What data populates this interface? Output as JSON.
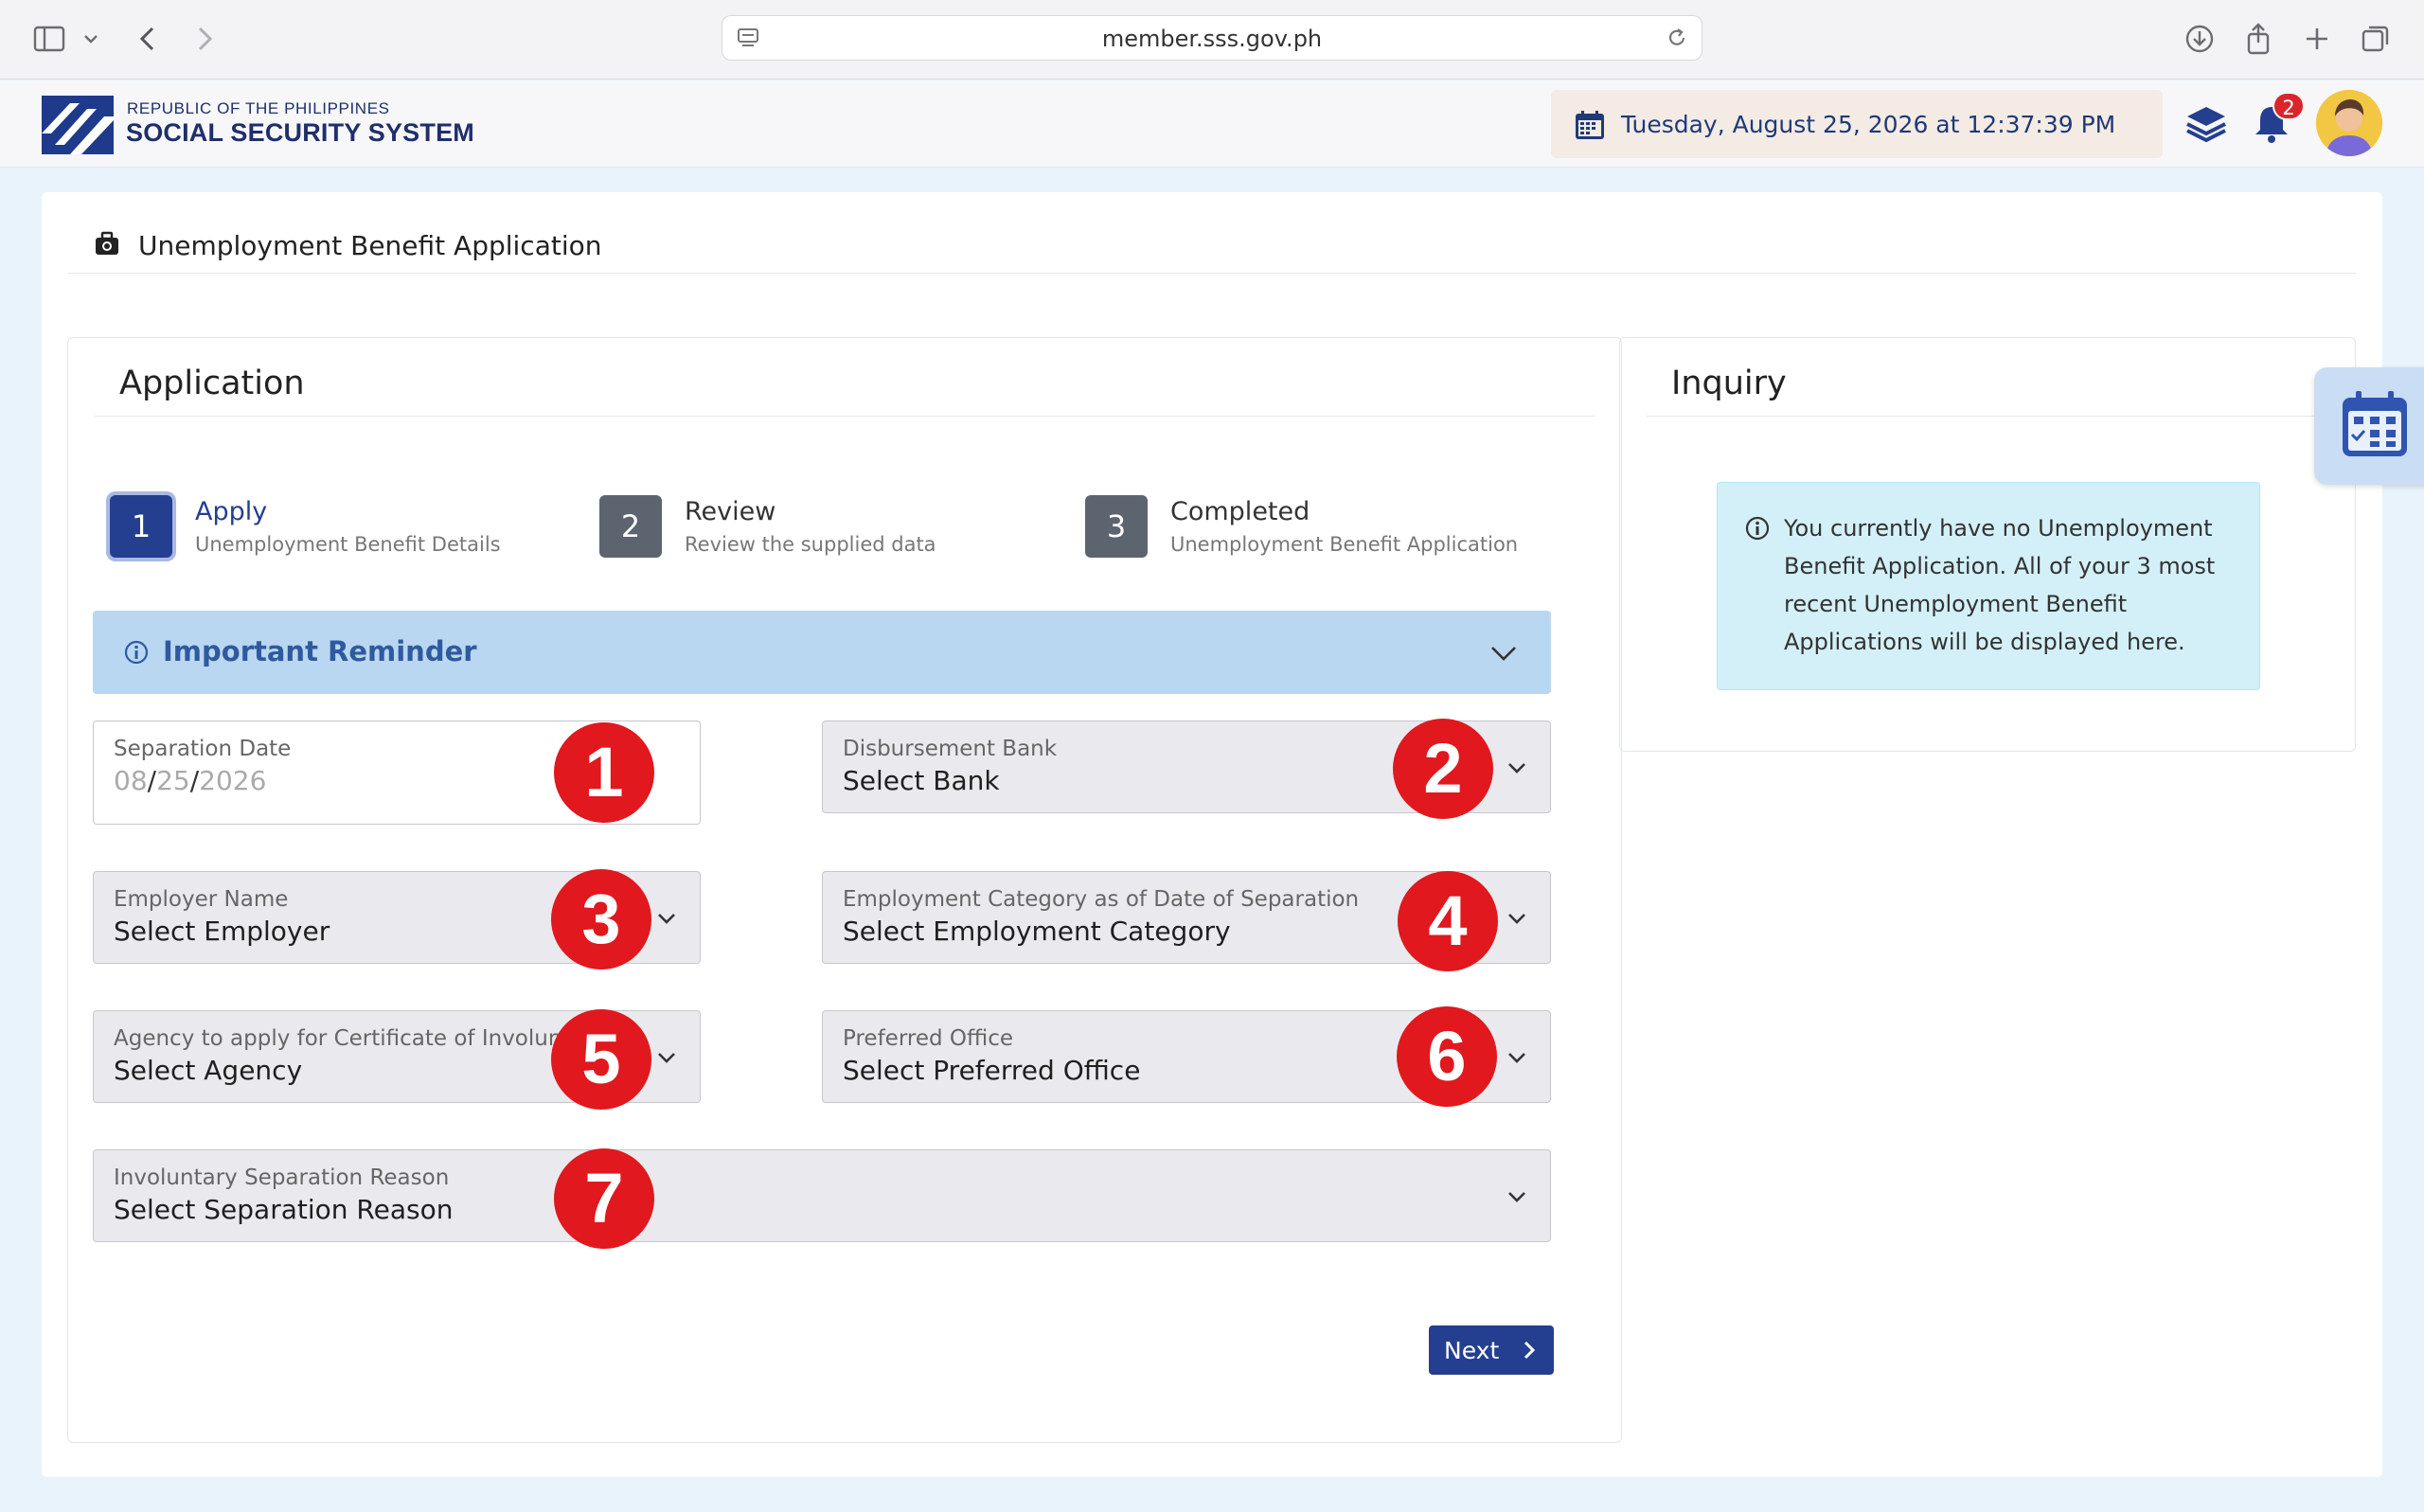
{
  "browser": {
    "url": "member.sss.gov.ph"
  },
  "header": {
    "logo_line1": "REPUBLIC OF THE PHILIPPINES",
    "logo_line2": "SOCIAL SECURITY SYSTEM",
    "datetime": "Tuesday, August 25, 2026 at 12:37:39 PM",
    "notification_count": "2"
  },
  "page": {
    "title": "Unemployment Benefit Application"
  },
  "application": {
    "title": "Application",
    "steps": [
      {
        "number": "1",
        "title": "Apply",
        "subtitle": "Unemployment Benefit Details",
        "active": true
      },
      {
        "number": "2",
        "title": "Review",
        "subtitle": "Review the supplied data",
        "active": false
      },
      {
        "number": "3",
        "title": "Completed",
        "subtitle": "Unemployment Benefit Application",
        "active": false
      }
    ],
    "reminder": "Important Reminder",
    "fields": {
      "separation_date": {
        "label": "Separation Date",
        "month": "08",
        "day": "25",
        "year": "2026"
      },
      "bank": {
        "label": "Disbursement Bank",
        "value": "Select Bank"
      },
      "employer": {
        "label": "Employer Name",
        "value": "Select Employer"
      },
      "category": {
        "label": "Employment Category as of Date of Separation",
        "value": "Select Employment Category"
      },
      "agency": {
        "label": "Agency to apply for Certificate of Involuntary Separation",
        "value": "Select Agency"
      },
      "office": {
        "label": "Preferred Office",
        "value": "Select Preferred Office"
      },
      "reason": {
        "label": "Involuntary Separation Reason",
        "value": "Select Separation Reason"
      }
    },
    "markers": [
      "1",
      "2",
      "3",
      "4",
      "5",
      "6",
      "7"
    ],
    "next_label": "Next"
  },
  "inquiry": {
    "title": "Inquiry",
    "message": "You currently have no Unemployment Benefit Application. All of your 3 most recent Unemployment Benefit Applications will be displayed here."
  },
  "colors": {
    "brand": "#243f8f",
    "marker": "#e1181e",
    "reminder_bg": "#b9d7f0",
    "info_bg": "#d3f0f8"
  }
}
